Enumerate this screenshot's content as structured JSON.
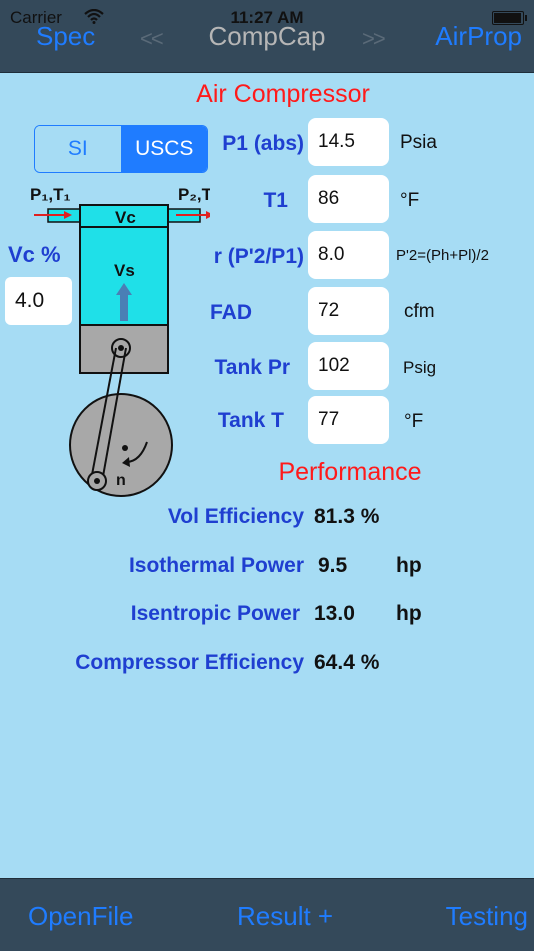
{
  "status": {
    "carrier": "Carrier",
    "time": "11:27 AM"
  },
  "nav": {
    "left": "Spec",
    "title": "CompCap",
    "prev_arrows": "<<",
    "next_arrows": ">>",
    "right": "AirProp"
  },
  "compressor": {
    "title": "Air Compressor",
    "units_toggle": {
      "si": "SI",
      "uscs": "USCS",
      "selected": "USCS"
    },
    "vc_label": "Vc %",
    "vc_value": "4.0",
    "inputs": [
      {
        "label": "P1 (abs)",
        "value": "14.5",
        "unit": "Psia"
      },
      {
        "label": "T1",
        "value": "86",
        "unit": "°F"
      },
      {
        "label": "r (P'2/P1)",
        "value": "8.0",
        "unit": "P'2=(Ph+Pl)/2"
      },
      {
        "label": "FAD",
        "value": "72",
        "unit": "cfm"
      },
      {
        "label": "Tank Pr",
        "value": "102",
        "unit": "Psig"
      },
      {
        "label": "Tank T",
        "value": "77",
        "unit": "°F"
      }
    ],
    "diagram": {
      "p1t1": "P₁,T₁",
      "p2t2": "P₂,T₂",
      "vc": "Vc",
      "vs": "Vs",
      "n": "n"
    }
  },
  "performance": {
    "title": "Performance",
    "rows": [
      {
        "label": "Vol Efficiency",
        "value": "81.3 %",
        "unit": ""
      },
      {
        "label": "Isothermal Power",
        "value": "9.5",
        "unit": "hp"
      },
      {
        "label": "Isentropic Power",
        "value": "13.0",
        "unit": "hp"
      },
      {
        "label": "Compressor Efficiency",
        "value": "64.4 %",
        "unit": ""
      }
    ]
  },
  "bottom": {
    "left": "OpenFile",
    "center": "Result +",
    "right": "Testing"
  },
  "colors": {
    "background": "#a6dcf4",
    "bar": "#34495a",
    "accent": "#1f7cff",
    "title_red": "#ff1a1a",
    "label_blue": "#1f3fd0"
  }
}
